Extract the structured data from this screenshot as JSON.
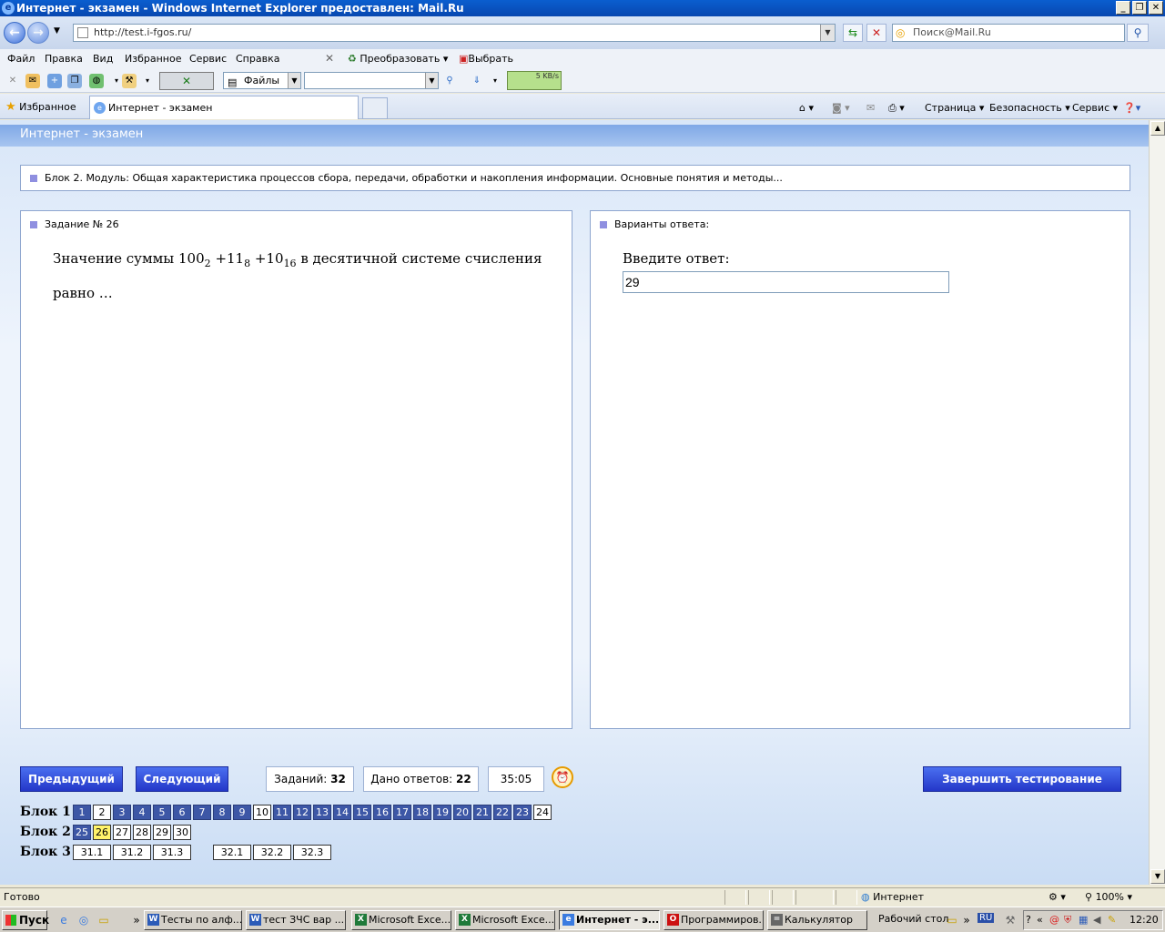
{
  "window": {
    "title": "Интернет - экзамен - Windows Internet Explorer предоставлен: Mail.Ru"
  },
  "address": {
    "url": "http://test.i-fgos.ru/",
    "search_placeholder": "Поиск@Mail.Ru"
  },
  "menu": [
    "Файл",
    "Правка",
    "Вид",
    "Избранное",
    "Сервис",
    "Справка"
  ],
  "toolbar": {
    "convert_label": "Преобразовать",
    "choose_label": "Выбрать",
    "files_label": "Файлы",
    "speed": "5 KB/s"
  },
  "tabs": {
    "favorites_label": "Избранное",
    "active_tab": "Интернет - экзамен",
    "commands": [
      "Страница",
      "Безопасность",
      "Сервис"
    ]
  },
  "page": {
    "header": "Интернет - экзамен",
    "block_title": "Блок 2. Модуль: Общая характеристика процессов сбора, передачи, обработки и накопления информации. Основные понятия и методы...",
    "task_label": "Задание № 26",
    "question": {
      "prefix": "Значение суммы",
      "t1": "100",
      "s1": "2",
      "t2": "11",
      "s2": "8",
      "t3": "10",
      "s3": "16",
      "plus": "+",
      "suffix": "в десятичной системе счисления",
      "line2": "равно …"
    },
    "answers_label": "Варианты ответа:",
    "enter_label": "Введите ответ:",
    "answer_value": "29"
  },
  "controls": {
    "prev_label": "Предыдущий",
    "next_label": "Следующий",
    "tasks_label": "Заданий:",
    "tasks_count": "32",
    "answered_label": "Дано ответов:",
    "answered_count": "22",
    "timer": "35:05",
    "finish_label": "Завершить тестирование"
  },
  "blocks": [
    {
      "label": "Блок 1",
      "items": [
        {
          "n": "1",
          "s": "done"
        },
        {
          "n": "2",
          "s": "empty"
        },
        {
          "n": "3",
          "s": "done"
        },
        {
          "n": "4",
          "s": "done"
        },
        {
          "n": "5",
          "s": "done"
        },
        {
          "n": "6",
          "s": "done"
        },
        {
          "n": "7",
          "s": "done"
        },
        {
          "n": "8",
          "s": "done"
        },
        {
          "n": "9",
          "s": "done"
        },
        {
          "n": "10",
          "s": "empty"
        },
        {
          "n": "11",
          "s": "done"
        },
        {
          "n": "12",
          "s": "done"
        },
        {
          "n": "13",
          "s": "done"
        },
        {
          "n": "14",
          "s": "done"
        },
        {
          "n": "15",
          "s": "done"
        },
        {
          "n": "16",
          "s": "done"
        },
        {
          "n": "17",
          "s": "done"
        },
        {
          "n": "18",
          "s": "done"
        },
        {
          "n": "19",
          "s": "done"
        },
        {
          "n": "20",
          "s": "done"
        },
        {
          "n": "21",
          "s": "done"
        },
        {
          "n": "22",
          "s": "done"
        },
        {
          "n": "23",
          "s": "done"
        },
        {
          "n": "24",
          "s": "empty"
        }
      ]
    },
    {
      "label": "Блок 2",
      "items": [
        {
          "n": "25",
          "s": "done"
        },
        {
          "n": "26",
          "s": "current"
        },
        {
          "n": "27",
          "s": "empty"
        },
        {
          "n": "28",
          "s": "empty"
        },
        {
          "n": "29",
          "s": "empty"
        },
        {
          "n": "30",
          "s": "empty"
        }
      ]
    },
    {
      "label": "Блок 3",
      "items": [
        {
          "n": "31.1",
          "s": "empty"
        },
        {
          "n": "31.2",
          "s": "empty"
        },
        {
          "n": "31.3",
          "s": "empty"
        },
        {
          "n": "32.1",
          "s": "empty"
        },
        {
          "n": "32.2",
          "s": "empty"
        },
        {
          "n": "32.3",
          "s": "empty"
        }
      ]
    }
  ],
  "status": {
    "text": "Готово",
    "zone": "Интернет",
    "zoom": "100%"
  },
  "taskbar": {
    "start_label": "Пуск",
    "tasks": [
      {
        "label": "Тесты по алф...",
        "icon": "W",
        "color": "#2b5bb8"
      },
      {
        "label": "тест ЗЧС вар ...",
        "icon": "W",
        "color": "#2b5bb8"
      },
      {
        "label": "Microsoft Exce...",
        "icon": "X",
        "color": "#1f7a3a"
      },
      {
        "label": "Microsoft Exce...",
        "icon": "X",
        "color": "#1f7a3a"
      },
      {
        "label": "Интернет - э...",
        "icon": "e",
        "color": "#3a7be0"
      },
      {
        "label": "Программиров...",
        "icon": "O",
        "color": "#cc1111"
      },
      {
        "label": "Калькулятор",
        "icon": "=",
        "color": "#666666"
      }
    ],
    "desktop_label": "Рабочий стол",
    "lang": "RU",
    "time": "12:20"
  }
}
